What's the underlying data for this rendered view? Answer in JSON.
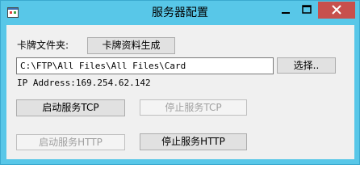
{
  "window": {
    "title": "服务器配置"
  },
  "caption_buttons": {
    "minimize": "minimize-icon",
    "maximize": "maximize-icon",
    "close": "close-icon"
  },
  "form": {
    "folder_label": "卡牌文件夹:",
    "generate_button": "卡牌资料生成",
    "path_value": "C:\\FTP\\All Files\\All Files\\Card",
    "browse_button": "选择..",
    "ip_address": "IP Address:169.254.62.142",
    "start_tcp_button": "启动服务TCP",
    "stop_tcp_button": "停止服务TCP",
    "start_http_button": "启动服务HTTP",
    "stop_http_button": "停止服务HTTP"
  },
  "colors": {
    "titlebar": "#58c7e8",
    "close_button": "#c7504d",
    "client_background": "#f0f0f0"
  }
}
